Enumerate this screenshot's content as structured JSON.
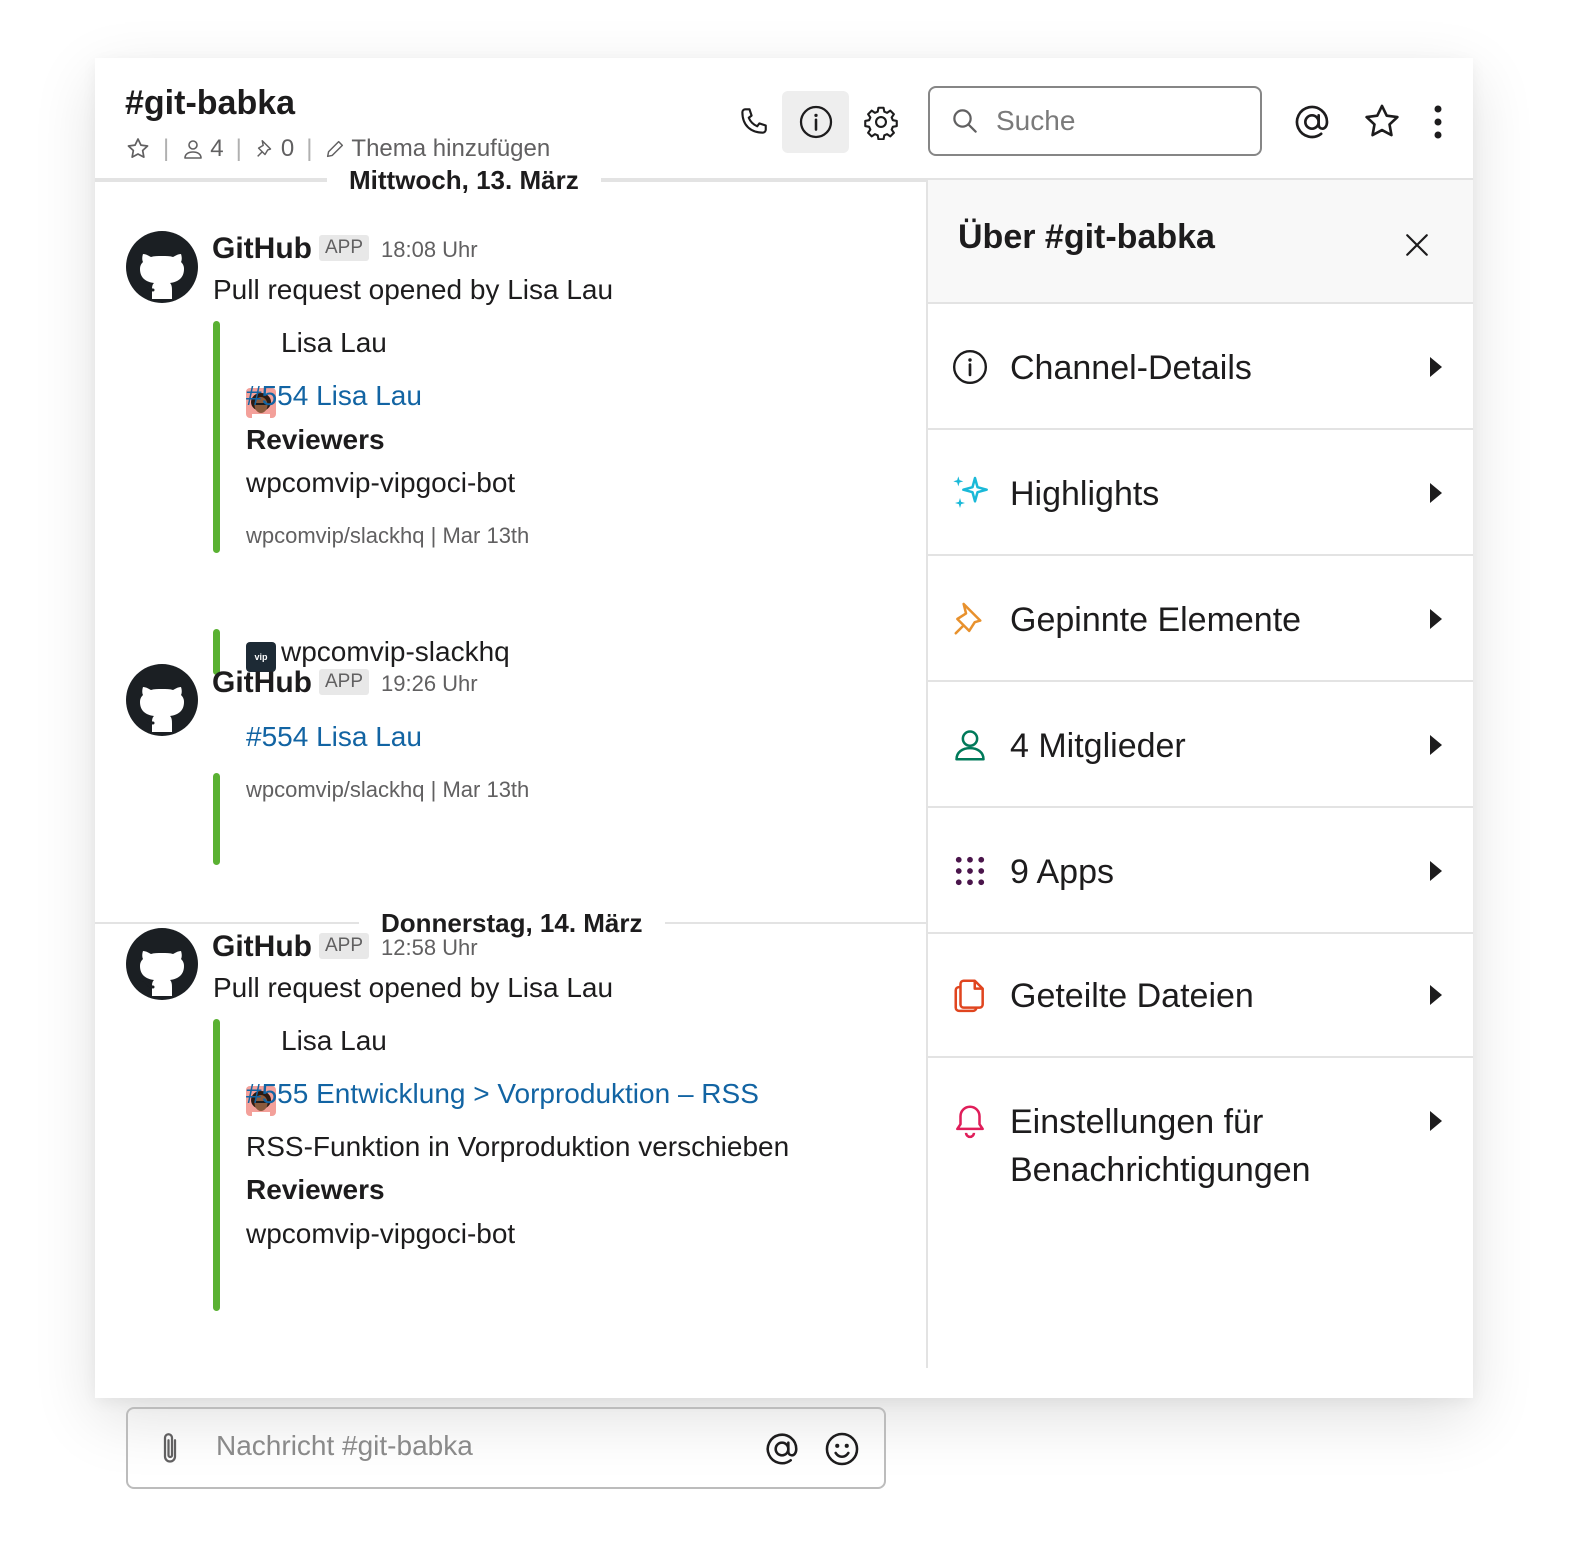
{
  "header": {
    "channel_name": "#git-babka",
    "members_count": "4",
    "pins_count": "0",
    "topic_placeholder": "Thema hinzufügen",
    "search_placeholder": "Suche"
  },
  "messages": {
    "day1": "Mittwoch, 13. März",
    "day2": "Donnerstag, 14. März",
    "m1": {
      "author": "GitHub",
      "badge": "APP",
      "time": "18:08 Uhr",
      "text": "Pull request opened by Lisa Lau",
      "att_user": "Lisa Lau",
      "att_link": "#554 Lisa Lau",
      "att_reviewers_label": "Reviewers",
      "att_reviewer": "wpcomvip-vipgoci-bot",
      "att_footer": "wpcomvip/slackhq | Mar 13th",
      "att2_org": "wpcomvip-slackhq",
      "att2_org_logo": "vip"
    },
    "m2": {
      "author": "GitHub",
      "badge": "APP",
      "time": "19:26 Uhr",
      "att_link": "#554 Lisa Lau",
      "att_footer": "wpcomvip/slackhq | Mar 13th"
    },
    "m3": {
      "author": "GitHub",
      "badge": "APP",
      "time": "12:58 Uhr",
      "text": "Pull request opened by Lisa Lau",
      "att_user": "Lisa Lau",
      "att_link": "#555 Entwicklung > Vorproduktion – RSS",
      "att_desc": "RSS-Funktion in Vorproduktion verschieben",
      "att_reviewers_label": "Reviewers",
      "att_reviewer": "wpcomvip-vipgoci-bot"
    }
  },
  "composer": {
    "placeholder": "Nachricht #git-babka"
  },
  "panel": {
    "title": "Über #git-babka",
    "items": [
      {
        "label": "Channel-Details",
        "icon": "info-icon",
        "color": "#1d1c1d"
      },
      {
        "label": "Highlights",
        "icon": "sparkles-icon",
        "color": "#1ab9d8"
      },
      {
        "label": "Gepinnte Elemente",
        "icon": "pin-icon",
        "color": "#e8912d"
      },
      {
        "label": "4 Mitglieder",
        "icon": "person-icon",
        "color": "#007a5a"
      },
      {
        "label": "9 Apps",
        "icon": "apps-grid-icon",
        "color": "#4a154b"
      },
      {
        "label": "Geteilte Dateien",
        "icon": "files-icon",
        "color": "#e0451f"
      },
      {
        "label": "Einstellungen für Benachrichtigungen",
        "icon": "bell-icon",
        "color": "#e01e5a"
      }
    ]
  },
  "colors": {
    "link": "#1264a3",
    "attachment_bar": "#5ab132",
    "border": "#e3e3e3"
  }
}
